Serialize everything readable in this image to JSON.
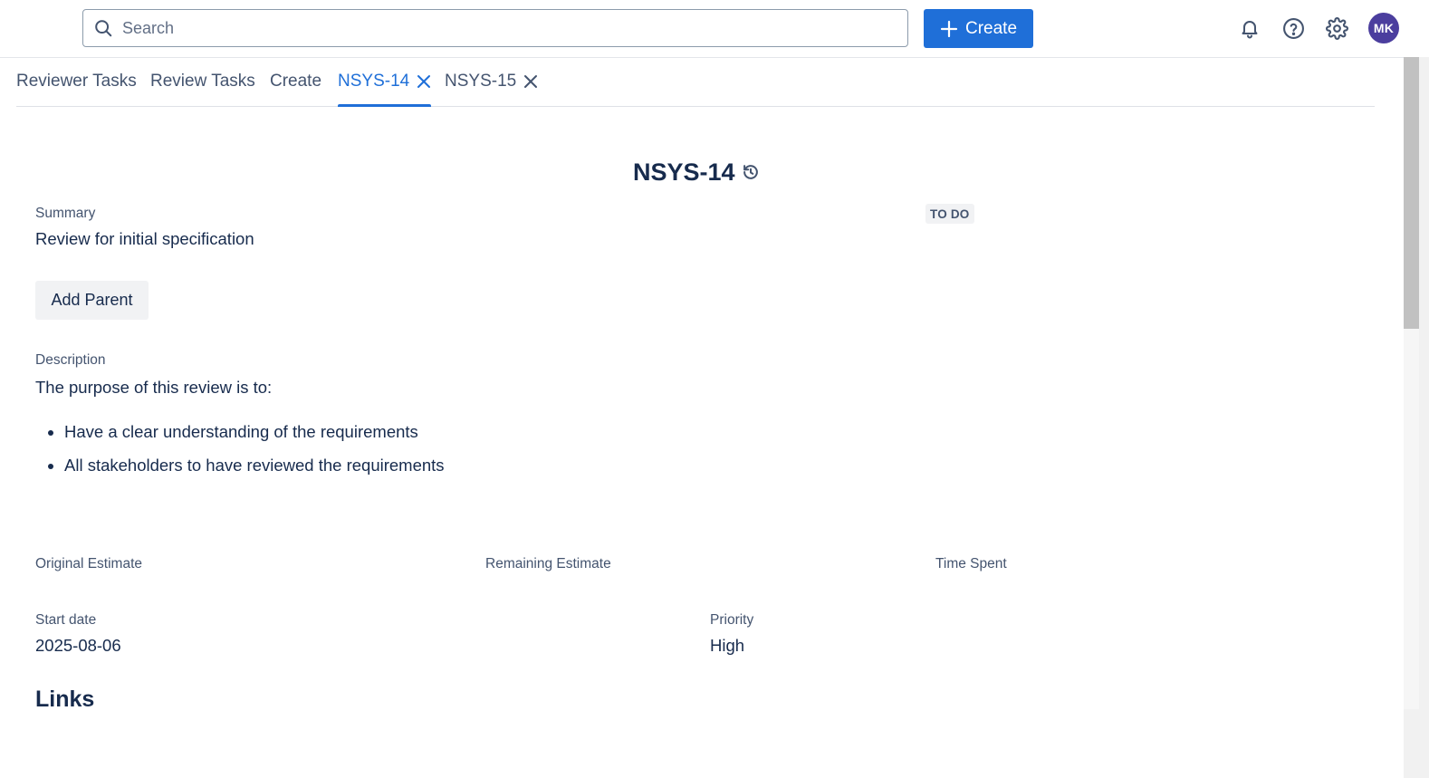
{
  "search": {
    "placeholder": "Search"
  },
  "header": {
    "create_label": "Create",
    "avatar_initials": "MK"
  },
  "tabs": [
    {
      "label": "Reviewer Tasks"
    },
    {
      "label": "Review Tasks"
    },
    {
      "label": "Create"
    },
    {
      "label": "NSYS-14",
      "closable": true,
      "active": true
    },
    {
      "label": "NSYS-15",
      "closable": true
    }
  ],
  "issue": {
    "key": "NSYS-14",
    "status": "TO DO",
    "summary_label": "Summary",
    "summary": "Review for initial specification",
    "add_parent_label": "Add Parent",
    "description_label": "Description",
    "description_intro": "The purpose of this review is to:",
    "description_items": [
      "Have a clear understanding of the requirements",
      "All stakeholders to have reviewed the requirements"
    ],
    "original_estimate_label": "Original Estimate",
    "remaining_estimate_label": "Remaining Estimate",
    "time_spent_label": "Time Spent",
    "start_date_label": "Start date",
    "start_date": "2025-08-06",
    "priority_label": "Priority",
    "priority": "High",
    "links_heading": "Links"
  },
  "colors": {
    "accent": "#1f6fd8",
    "avatar_bg": "#4b3e9e",
    "text_primary": "#172b4d",
    "text_secondary": "#44546f"
  },
  "icons": {
    "search": "search-icon",
    "create": "plus-icon",
    "notifications": "bell-icon",
    "help": "help-icon",
    "settings": "gear-icon",
    "tab_close": "close-icon",
    "history": "history-icon"
  }
}
